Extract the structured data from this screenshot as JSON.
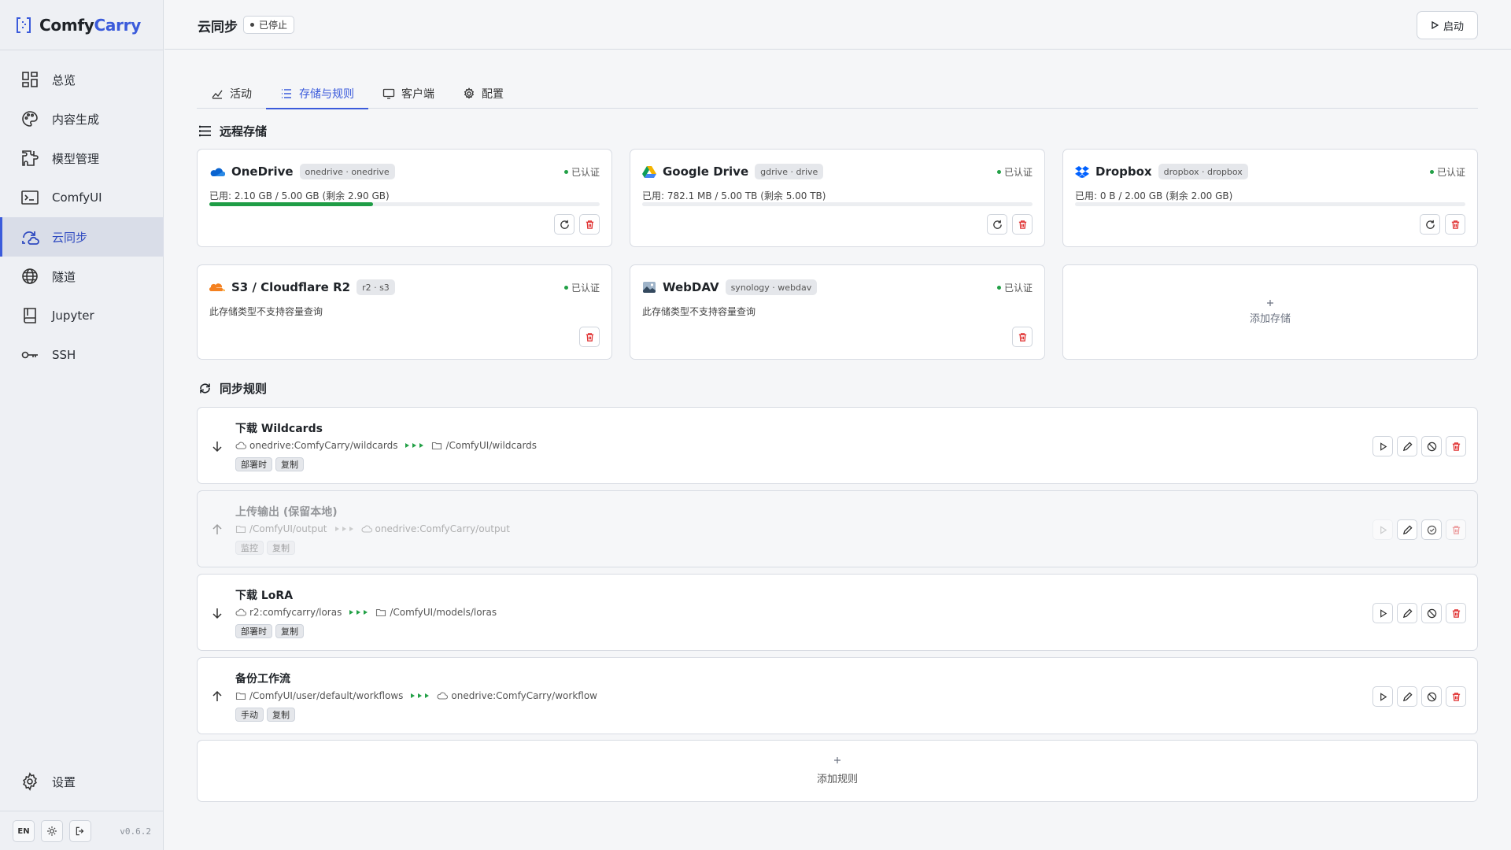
{
  "app": {
    "name_part1": "Comfy",
    "name_part2": "Carry",
    "version": "v0.6.2",
    "lang_button": "EN"
  },
  "sidebar": {
    "items": [
      {
        "label": "总览",
        "icon": "dashboard-icon"
      },
      {
        "label": "内容生成",
        "icon": "palette-icon"
      },
      {
        "label": "模型管理",
        "icon": "puzzle-icon"
      },
      {
        "label": "ComfyUI",
        "icon": "terminal-icon"
      },
      {
        "label": "云同步",
        "icon": "cloud-sync-icon",
        "active": true
      },
      {
        "label": "隧道",
        "icon": "globe-icon"
      },
      {
        "label": "Jupyter",
        "icon": "notebook-icon"
      },
      {
        "label": "SSH",
        "icon": "key-icon"
      }
    ],
    "settings_label": "设置"
  },
  "header": {
    "title": "云同步",
    "status": "已停止",
    "start_label": "启动"
  },
  "tabs": [
    {
      "label": "活动",
      "icon": "activity-chart-icon"
    },
    {
      "label": "存储与规则",
      "icon": "list-icon",
      "active": true
    },
    {
      "label": "客户端",
      "icon": "monitor-icon"
    },
    {
      "label": "配置",
      "icon": "gear-icon"
    }
  ],
  "remote_storage": {
    "title": "远程存储",
    "cards": [
      {
        "name": "OneDrive",
        "chip": "onedrive · onedrive",
        "auth": "已认证",
        "usage": "已用: 2.10 GB / 5.00 GB (剩余 2.90 GB)",
        "used_fraction": 0.42,
        "icon": "onedrive-icon"
      },
      {
        "name": "Google Drive",
        "chip": "gdrive · drive",
        "auth": "已认证",
        "usage": "已用: 782.1 MB / 5.00 TB (剩余 5.00 TB)",
        "used_fraction": 0.0,
        "icon": "google-drive-icon"
      },
      {
        "name": "Dropbox",
        "chip": "dropbox · dropbox",
        "auth": "已认证",
        "usage": "已用: 0 B / 2.00 GB (剩余 2.00 GB)",
        "used_fraction": 0.0,
        "icon": "dropbox-icon"
      },
      {
        "name": "S3 / Cloudflare R2",
        "chip": "r2 · s3",
        "auth": "已认证",
        "usage": "此存储类型不支持容量查询",
        "icon": "cloudflare-icon"
      },
      {
        "name": "WebDAV",
        "chip": "synology · webdav",
        "auth": "已认证",
        "usage": "此存储类型不支持容量查询",
        "icon": "webdav-icon"
      }
    ],
    "add_label": "添加存储"
  },
  "sync_rules": {
    "title": "同步规则",
    "rules": [
      {
        "title": "下载 Wildcards",
        "direction": "down",
        "source": "onedrive:ComfyCarry/wildcards",
        "source_type": "cloud",
        "dest": "/ComfyUI/wildcards",
        "dest_type": "folder",
        "tags": [
          "部署时",
          "复制"
        ],
        "enabled": true
      },
      {
        "title": "上传输出 (保留本地)",
        "direction": "up",
        "source": "/ComfyUI/output",
        "source_type": "folder",
        "dest": "onedrive:ComfyCarry/output",
        "dest_type": "cloud",
        "tags": [
          "监控",
          "复制"
        ],
        "enabled": false
      },
      {
        "title": "下载 LoRA",
        "direction": "down",
        "source": "r2:comfycarry/loras",
        "source_type": "cloud",
        "dest": "/ComfyUI/models/loras",
        "dest_type": "folder",
        "tags": [
          "部署时",
          "复制"
        ],
        "enabled": true
      },
      {
        "title": "备份工作流",
        "direction": "up",
        "source": "/ComfyUI/user/default/workflows",
        "source_type": "folder",
        "dest": "onedrive:ComfyCarry/workflow",
        "dest_type": "cloud",
        "tags": [
          "手动",
          "复制"
        ],
        "enabled": true
      }
    ],
    "add_label": "添加规则"
  },
  "colors": {
    "accent": "#3b5bdb",
    "success": "#22a046",
    "danger": "#e03131"
  }
}
